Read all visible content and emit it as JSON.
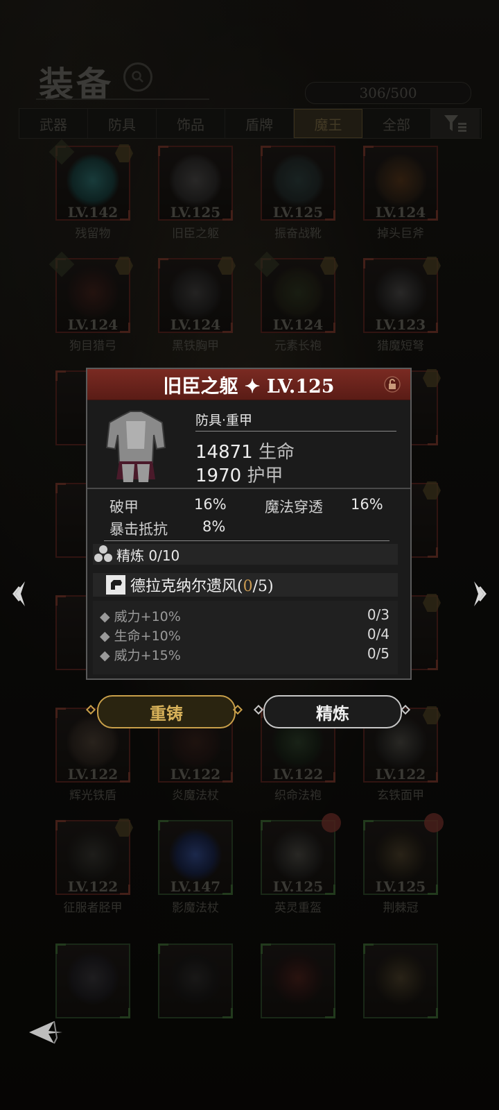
{
  "header": {
    "title": "装备",
    "count": "306/500"
  },
  "tabs": [
    {
      "label": "武器"
    },
    {
      "label": "防具"
    },
    {
      "label": "饰品"
    },
    {
      "label": "盾牌"
    },
    {
      "label": "魔王"
    },
    {
      "label": "全部"
    }
  ],
  "grid": [
    {
      "lv": "LV.142",
      "name": "残留物"
    },
    {
      "lv": "LV.125",
      "name": "旧臣之躯"
    },
    {
      "lv": "LV.125",
      "name": "振奋战靴"
    },
    {
      "lv": "LV.124",
      "name": "掉头巨斧"
    },
    {
      "lv": "LV.124",
      "name": "狗目猎弓"
    },
    {
      "lv": "LV.124",
      "name": "黑铁胸甲"
    },
    {
      "lv": "LV.124",
      "name": "元素长袍"
    },
    {
      "lv": "LV.123",
      "name": "猎魔短弩"
    },
    {
      "lv": "LV.122",
      "name": "辉光铁盾"
    },
    {
      "lv": "LV.122",
      "name": "炎魔法杖"
    },
    {
      "lv": "LV.122",
      "name": "织命法袍"
    },
    {
      "lv": "LV.122",
      "name": "玄铁面甲"
    },
    {
      "lv": "LV.122",
      "name": "征服者胫甲"
    },
    {
      "lv": "LV.147",
      "name": "影魔法杖"
    },
    {
      "lv": "LV.125",
      "name": "英灵重盔"
    },
    {
      "lv": "LV.125",
      "name": "荆棘冠"
    }
  ],
  "popup": {
    "title": "旧臣之躯 ✦ LV.125",
    "category": "防具·重甲",
    "hp_value": "14871",
    "hp_unit": "生命",
    "armor_value": "1970",
    "armor_unit": "护甲",
    "stats": [
      {
        "label": "破甲",
        "value": "16%"
      },
      {
        "label": "魔法穿透",
        "value": "16%"
      },
      {
        "label": "暴击抵抗",
        "value": "8%"
      }
    ],
    "refine": "精炼 0/10",
    "set_name": "德拉克纳尔遗风(",
    "set_current": "0",
    "set_total": "/5)",
    "bonuses": [
      {
        "label": "威力+10%",
        "progress": "0/3"
      },
      {
        "label": "生命+10%",
        "progress": "0/4"
      },
      {
        "label": "威力+15%",
        "progress": "0/5"
      }
    ]
  },
  "buttons": {
    "recast": "重铸",
    "refine": "精炼"
  },
  "icons": {
    "search": "search-icon",
    "filter": "filter-icon",
    "lock": "lock-icon",
    "arrow_left": "arrow-left-icon",
    "arrow_right": "arrow-right-icon",
    "back": "back-icon"
  }
}
